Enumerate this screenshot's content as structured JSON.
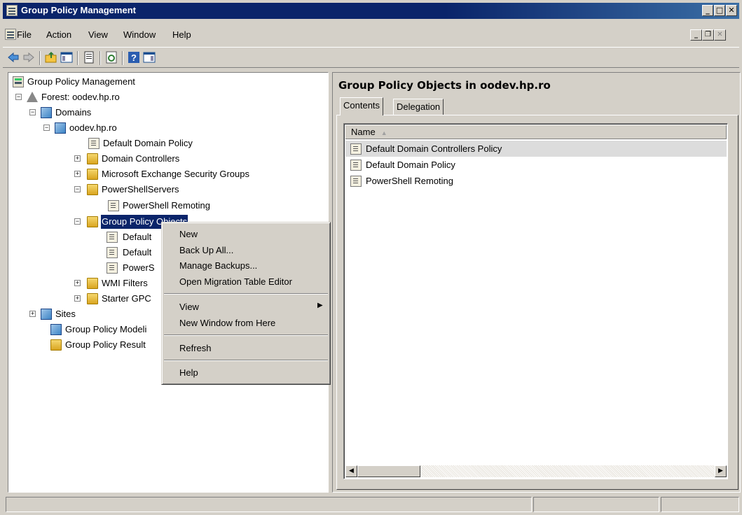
{
  "window": {
    "title": "Group Policy Management"
  },
  "menubar": {
    "items": [
      "File",
      "Action",
      "View",
      "Window",
      "Help"
    ]
  },
  "tree": {
    "items": [
      {
        "label": "Group Policy Management",
        "icon": "gpmc-console-icon"
      },
      {
        "label": "Forest: oodev.hp.ro",
        "icon": "forest-icon"
      },
      {
        "label": "Domains",
        "icon": "domains-icon"
      },
      {
        "label": "oodev.hp.ro",
        "icon": "domain-icon"
      },
      {
        "label": "Default Domain Policy",
        "icon": "gpo-link-icon"
      },
      {
        "label": "Domain Controllers",
        "icon": "ou-folder-icon"
      },
      {
        "label": "Microsoft Exchange Security Groups",
        "icon": "ou-folder-icon"
      },
      {
        "label": "PowerShellServers",
        "icon": "ou-folder-icon"
      },
      {
        "label": "PowerShell Remoting",
        "icon": "gpo-link-icon"
      },
      {
        "label": "Group Policy Objects",
        "icon": "gpo-folder-icon"
      },
      {
        "label": "Default",
        "icon": "gpo-icon"
      },
      {
        "label": "Default",
        "icon": "gpo-icon"
      },
      {
        "label": "PowerS",
        "icon": "gpo-icon"
      },
      {
        "label": "WMI Filters",
        "icon": "wmi-folder-icon"
      },
      {
        "label": "Starter GPC",
        "icon": "starter-gpo-folder-icon"
      },
      {
        "label": "Sites",
        "icon": "sites-icon"
      },
      {
        "label": "Group Policy Modeli",
        "icon": "modeling-icon"
      },
      {
        "label": "Group Policy Result",
        "icon": "results-icon"
      }
    ]
  },
  "context_menu": {
    "items": [
      "New",
      "Back Up All...",
      "Manage Backups...",
      "Open Migration Table Editor",
      "View",
      "New Window from Here",
      "Refresh",
      "Help"
    ]
  },
  "right_pane": {
    "title": "Group Policy Objects in oodev.hp.ro",
    "tabs": [
      "Contents",
      "Delegation"
    ],
    "active_tab": "Contents",
    "column_header": "Name",
    "rows": [
      "Default Domain Controllers Policy",
      "Default Domain Policy",
      "PowerShell Remoting"
    ],
    "selected_row": "Default Domain Controllers Policy"
  },
  "colors": {
    "selection": "#0a246a",
    "titlebar": "#0a246a",
    "chrome": "#d4d0c8"
  }
}
